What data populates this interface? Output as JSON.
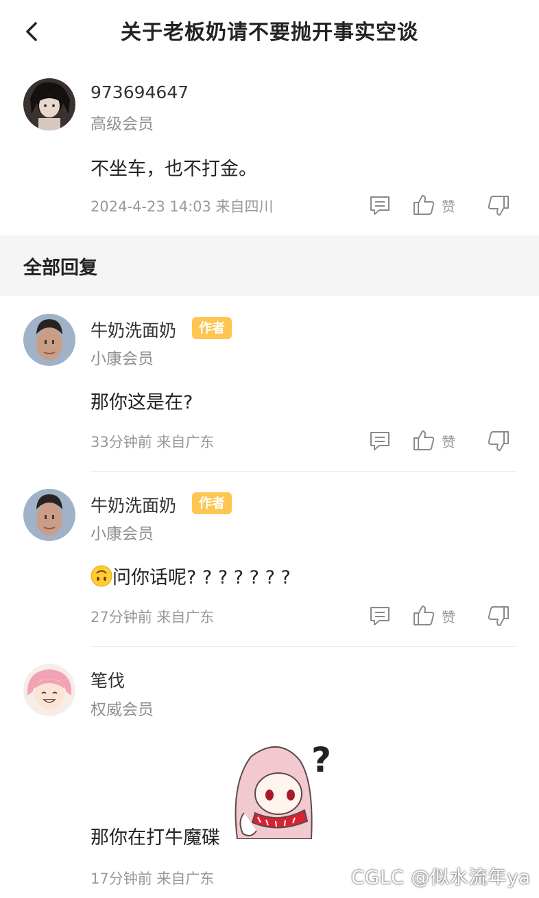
{
  "header": {
    "title": "关于老板奶请不要抛开事实空谈"
  },
  "post": {
    "username": "973694647",
    "level": "高级会员",
    "content": "不坐车，也不打金。",
    "meta": "2024-4-23 14:03  来自四川",
    "like_label": "赞"
  },
  "section": {
    "title": "全部回复"
  },
  "replies": [
    {
      "username": "牛奶洗面奶",
      "badge": "作者",
      "level": "小康会员",
      "content": "那你这是在?",
      "meta": "33分钟前 来自广东",
      "like_label": "赞"
    },
    {
      "username": "牛奶洗面奶",
      "badge": "作者",
      "level": "小康会员",
      "content": "问你话呢? ? ? ? ? ? ?",
      "meta": "27分钟前 来自广东",
      "like_label": "赞"
    },
    {
      "username": "笔伐",
      "level": "权威会员",
      "content": "那你在打牛魔碟",
      "meta": "17分钟前 来自广东"
    }
  ],
  "watermark": "CGLC @似水流年ya",
  "icons": [
    "chevron-left-icon",
    "comment-icon",
    "thumbs-up-icon",
    "thumbs-down-icon",
    "upside-down-face-emoji"
  ],
  "colors": {
    "badge": "#ffc553",
    "section_bg": "#f5f5f5",
    "meta_text": "#999999"
  }
}
